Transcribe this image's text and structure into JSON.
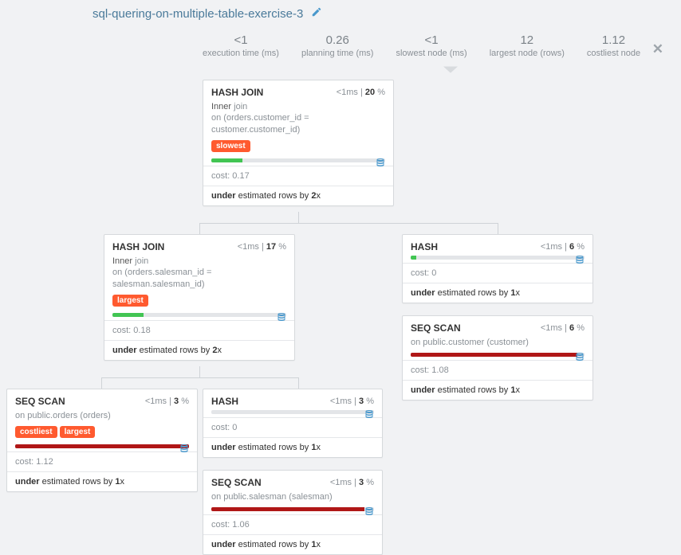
{
  "title": "sql-quering-on-multiple-table-exercise-3",
  "stats": [
    {
      "val": "<1",
      "lab": "execution time (ms)"
    },
    {
      "val": "0.26",
      "lab": "planning time (ms)"
    },
    {
      "val": "<1",
      "lab": "slowest node (ms)"
    },
    {
      "val": "12",
      "lab": "largest node (rows)"
    },
    {
      "val": "1.12",
      "lab": "costliest node"
    }
  ],
  "nodes": {
    "n0": {
      "name": "HASH JOIN",
      "ms": "<1",
      "pct": "20",
      "join_type": "Inner",
      "join_word": "join",
      "on": "on (orders.customer_id = customer.customer_id)",
      "tags": [
        "slowest"
      ],
      "bar_fill": 18,
      "bar_color": "#42c553",
      "cost": "0.17",
      "est_prefix": "under",
      "est_mid": " estimated rows by ",
      "est_mult": "2",
      "est_x": "x"
    },
    "n1": {
      "name": "HASH JOIN",
      "ms": "<1",
      "pct": "17",
      "join_type": "Inner",
      "join_word": "join",
      "on": "on (orders.salesman_id = salesman.salesman_id)",
      "tags": [
        "largest"
      ],
      "bar_fill": 18,
      "bar_color": "#42c553",
      "cost": "0.18",
      "est_prefix": "under",
      "est_mid": " estimated rows by ",
      "est_mult": "2",
      "est_x": "x"
    },
    "n2": {
      "name": "HASH",
      "ms": "<1",
      "pct": "6",
      "bar_fill": 3,
      "bar_color": "#42c553",
      "cost": "0",
      "est_prefix": "under",
      "est_mid": " estimated rows by ",
      "est_mult": "1",
      "est_x": "x"
    },
    "n3": {
      "name": "SEQ SCAN",
      "ms": "<1",
      "pct": "6",
      "scan_on": "on public.customer (customer)",
      "bar_fill": 96,
      "bar_color": "#b01717",
      "cost": "1.08",
      "est_prefix": "under",
      "est_mid": " estimated rows by ",
      "est_mult": "1",
      "est_x": "x"
    },
    "n4": {
      "name": "SEQ SCAN",
      "ms": "<1",
      "pct": "3",
      "scan_on": "on public.orders (orders)",
      "tags": [
        "costliest",
        "largest"
      ],
      "bar_fill": 100,
      "bar_color": "#b01717",
      "cost": "1.12",
      "est_prefix": "under",
      "est_mid": " estimated rows by ",
      "est_mult": "1",
      "est_x": "x"
    },
    "n5": {
      "name": "HASH",
      "ms": "<1",
      "pct": "3",
      "bar_fill": 0,
      "bar_color": "#42c553",
      "cost": "0",
      "est_prefix": "under",
      "est_mid": " estimated rows by ",
      "est_mult": "1",
      "est_x": "x"
    },
    "n6": {
      "name": "SEQ SCAN",
      "ms": "<1",
      "pct": "3",
      "scan_on": "on public.salesman (salesman)",
      "bar_fill": 94,
      "bar_color": "#b01717",
      "cost": "1.06",
      "est_prefix": "under",
      "est_mid": " estimated rows by ",
      "est_mult": "1",
      "est_x": "x"
    }
  },
  "labels": {
    "ms": "ms",
    "cost": "cost: ",
    "pipe": " | ",
    "pct": " %"
  }
}
